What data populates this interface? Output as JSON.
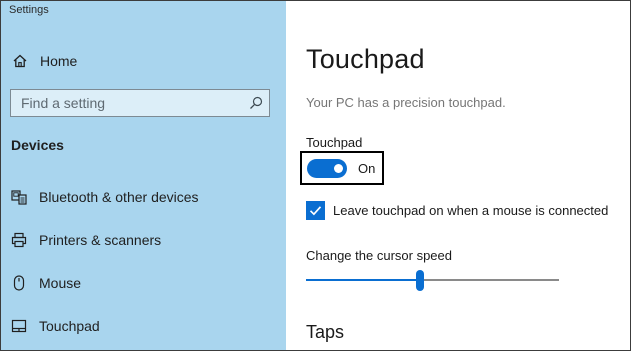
{
  "window": {
    "title": "Settings"
  },
  "sidebar": {
    "home_label": "Home",
    "search": {
      "placeholder": "Find a setting",
      "value": ""
    },
    "section_heading": "Devices",
    "items": [
      {
        "label": "Bluetooth & other devices",
        "icon": "bluetooth-devices-icon"
      },
      {
        "label": "Printers & scanners",
        "icon": "printer-icon"
      },
      {
        "label": "Mouse",
        "icon": "mouse-icon"
      },
      {
        "label": "Touchpad",
        "icon": "touchpad-icon"
      }
    ]
  },
  "main": {
    "title": "Touchpad",
    "description": "Your PC has a precision touchpad.",
    "touchpad_toggle": {
      "label": "Touchpad",
      "state_text": "On",
      "on": true
    },
    "leave_on_checkbox": {
      "label": "Leave touchpad on when a mouse is connected",
      "checked": true
    },
    "cursor_speed": {
      "label": "Change the cursor speed",
      "fraction": 0.45
    },
    "taps_heading": "Taps"
  },
  "colors": {
    "sidebar_bg": "#a9d5ee",
    "accent": "#0a6ed1",
    "description_text": "#767676"
  }
}
